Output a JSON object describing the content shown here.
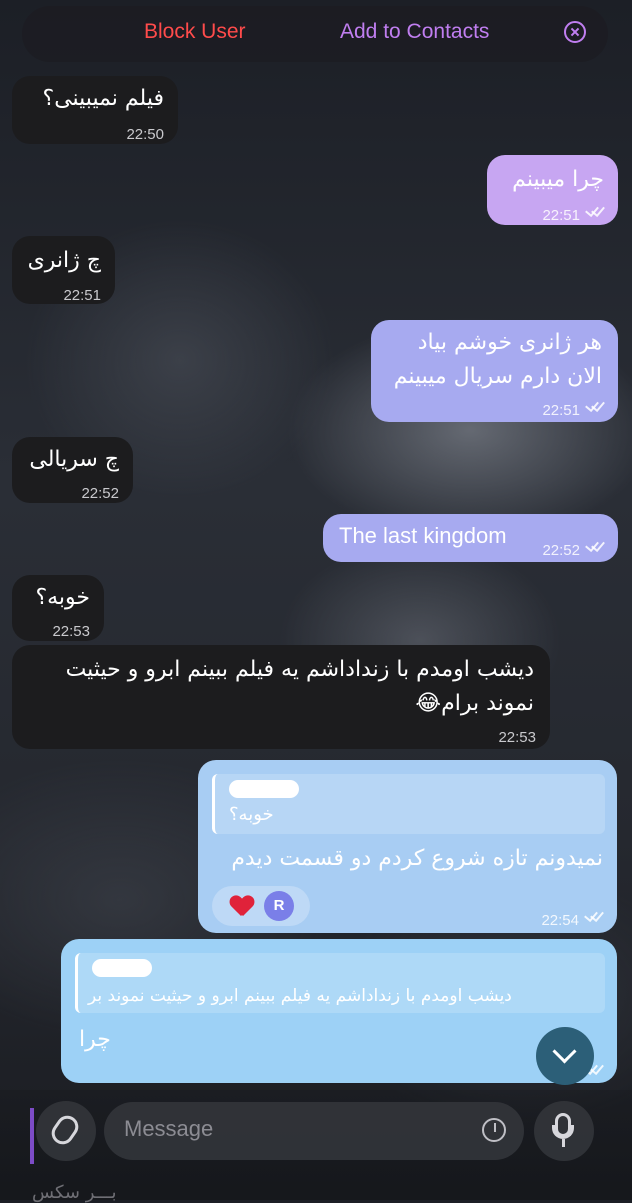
{
  "banner": {
    "block_label": "Block User",
    "add_label": "Add to Contacts",
    "close_icon": "close-circle-icon"
  },
  "messages": [
    {
      "text": "فیلم نمیبینی؟",
      "time": "22:50"
    },
    {
      "text": "چرا میبینم",
      "time": "22:51"
    },
    {
      "text": "چ ژانری",
      "time": "22:51"
    },
    {
      "line1": "هر ژانری خوشم بیاد",
      "line2": "الان دارم سریال میبینم",
      "time": "22:51"
    },
    {
      "text": "چ سریالی",
      "time": "22:52"
    },
    {
      "text": "The last kingdom",
      "time": "22:52"
    },
    {
      "text": "خوبه؟",
      "time": "22:53"
    },
    {
      "line1": "دیشب اومدم با زنداداشم یه فیلم ببینم ابرو و حیثیت",
      "line2": "نموند برام😂",
      "time": "22:53"
    },
    {
      "quote": "خوبه؟",
      "text": "نمیدونم تازه شروع کردم دو قسمت دیدم",
      "time": "22:54",
      "reaction_avatar": "R"
    },
    {
      "quote": "دیشب اومدم با زنداداشم یه فیلم ببینم ابرو و حیثیت نموند بر",
      "text": "چرا"
    }
  ],
  "input": {
    "placeholder": "Message"
  },
  "background_fragment": "بـــر سکس",
  "colors": {
    "incoming": "#1c1c1e",
    "outgoing_purple": "#c7a6f2",
    "outgoing_blue": "#9dd1f6",
    "block_red": "#ff4b4b",
    "accent_purple": "#c07ef0"
  }
}
